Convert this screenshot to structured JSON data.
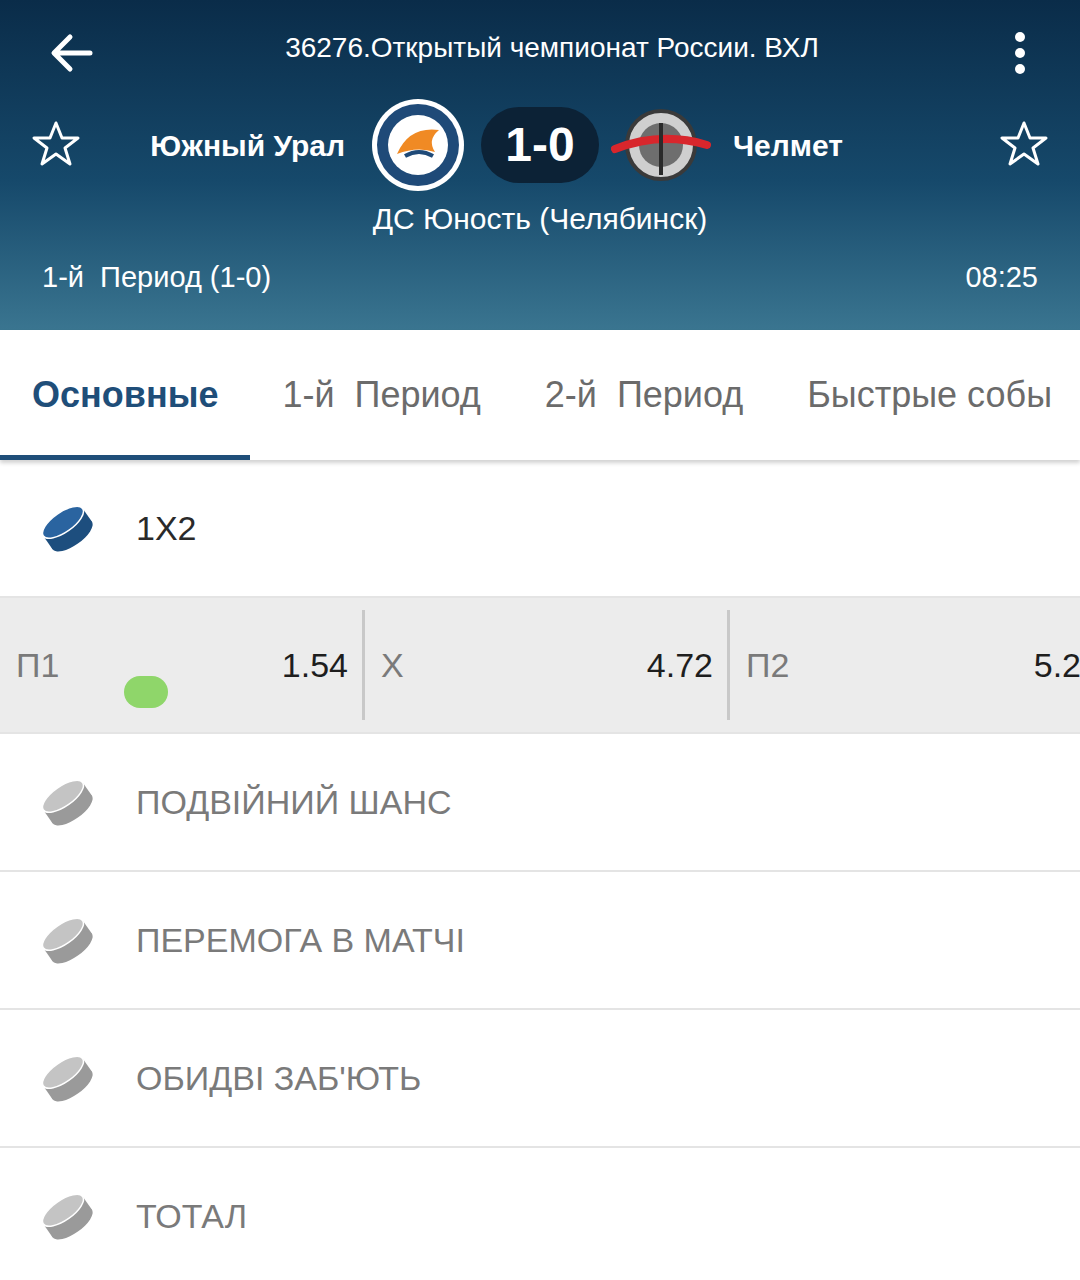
{
  "header": {
    "title": "36276.Открытый чемпионат России. ВХЛ",
    "home": {
      "name": "Южный Урал",
      "favorite": false
    },
    "away": {
      "name": "Челмет",
      "favorite": false
    },
    "score": "1-0",
    "venue": "ДС Юность (Челябинск)",
    "period": "1-й  Период (1-0)",
    "time": "08:25"
  },
  "tabs": [
    {
      "label": "Основные",
      "selected": true
    },
    {
      "label": "1-й  Период",
      "selected": false
    },
    {
      "label": "2-й  Период",
      "selected": false
    },
    {
      "label": "Быстрые собы",
      "selected": false
    }
  ],
  "markets": [
    {
      "title": "1X2",
      "expanded": true,
      "odds": [
        {
          "label": "П1",
          "value": "1.54",
          "dot": true
        },
        {
          "label": "X",
          "value": "4.72",
          "dot": false
        },
        {
          "label": "П2",
          "value": "5.2",
          "dot": false
        }
      ]
    },
    {
      "title": "ПОДВІЙНИЙ ШАНС",
      "expanded": false
    },
    {
      "title": "ПЕРЕМОГА В МАТЧІ",
      "expanded": false
    },
    {
      "title": "ОБИДВІ ЗАБ'ЮТЬ",
      "expanded": false
    },
    {
      "title": "ТОТАЛ",
      "expanded": false
    }
  ]
}
